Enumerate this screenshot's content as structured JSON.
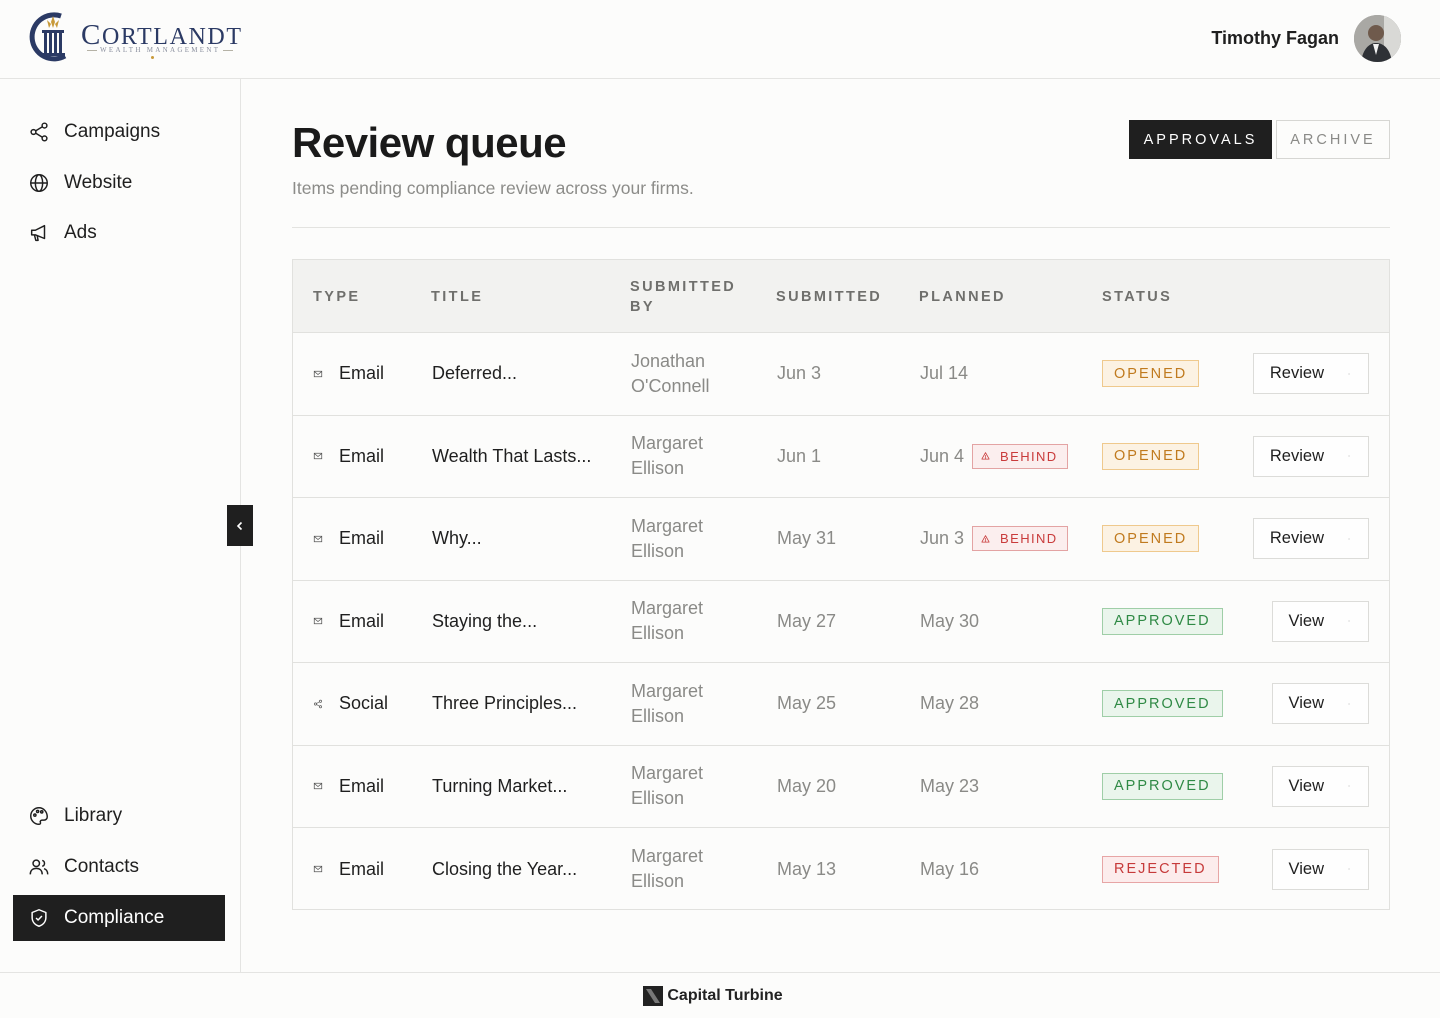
{
  "brand": {
    "name_first": "C",
    "name_rest": "ORTLANDT",
    "tagline": "WEALTH MANAGEMENT"
  },
  "user": {
    "name": "Timothy Fagan"
  },
  "sidebar": {
    "top_items": [
      {
        "label": "Campaigns",
        "icon": "share-nodes-icon"
      },
      {
        "label": "Website",
        "icon": "globe-icon"
      },
      {
        "label": "Ads",
        "icon": "megaphone-icon"
      }
    ],
    "bottom_items": [
      {
        "label": "Library",
        "icon": "palette-icon"
      },
      {
        "label": "Contacts",
        "icon": "users-icon"
      },
      {
        "label": "Compliance",
        "icon": "shield-check-icon",
        "active": true
      }
    ]
  },
  "main": {
    "title": "Review queue",
    "subtitle": "Items pending compliance review across your firms.",
    "tabs": [
      {
        "label": "APPROVALS",
        "active": true
      },
      {
        "label": "ARCHIVE",
        "active": false
      }
    ],
    "table": {
      "headers": {
        "type": "TYPE",
        "title": "TITLE",
        "submitted_by": "SUBMITTED BY",
        "submitted": "SUBMITTED",
        "planned": "PLANNED",
        "status": "STATUS"
      },
      "rows": [
        {
          "type": "Email",
          "icon": "envelope-icon",
          "title": "Deferred...",
          "by_first": "Jonathan",
          "by_last": "O'Connell",
          "submitted": "Jun 3",
          "planned": "Jul 14",
          "behind": "",
          "status": "OPENED",
          "action": "Review"
        },
        {
          "type": "Email",
          "icon": "envelope-icon",
          "title": "Wealth That Lasts...",
          "by_first": "Margaret",
          "by_last": "Ellison",
          "submitted": "Jun 1",
          "planned": "Jun 4",
          "behind": "BEHIND",
          "status": "OPENED",
          "action": "Review"
        },
        {
          "type": "Email",
          "icon": "envelope-icon",
          "title": "Why...",
          "by_first": "Margaret",
          "by_last": "Ellison",
          "submitted": "May 31",
          "planned": "Jun 3",
          "behind": "BEHIND",
          "status": "OPENED",
          "action": "Review"
        },
        {
          "type": "Email",
          "icon": "envelope-icon",
          "title": "Staying the...",
          "by_first": "Margaret",
          "by_last": "Ellison",
          "submitted": "May 27",
          "planned": "May 30",
          "behind": "",
          "status": "APPROVED",
          "action": "View"
        },
        {
          "type": "Social",
          "icon": "share-nodes-icon",
          "title": "Three Principles...",
          "by_first": "Margaret",
          "by_last": "Ellison",
          "submitted": "May 25",
          "planned": "May 28",
          "behind": "",
          "status": "APPROVED",
          "action": "View"
        },
        {
          "type": "Email",
          "icon": "envelope-icon",
          "title": "Turning Market...",
          "by_first": "Margaret",
          "by_last": "Ellison",
          "submitted": "May 20",
          "planned": "May 23",
          "behind": "",
          "status": "APPROVED",
          "action": "View"
        },
        {
          "type": "Email",
          "icon": "envelope-icon",
          "title": "Closing the Year...",
          "by_first": "Margaret",
          "by_last": "Ellison",
          "submitted": "May 13",
          "planned": "May 16",
          "behind": "",
          "status": "REJECTED",
          "action": "View"
        }
      ]
    }
  },
  "footer": {
    "text": "Capital Turbine"
  },
  "colors": {
    "ink": "#1f1f1f",
    "brand_navy": "#2b3a64",
    "brand_gold": "#c89a3a",
    "opened": "#c07a1e",
    "approved": "#2f8a45",
    "rejected": "#c63a3a"
  }
}
